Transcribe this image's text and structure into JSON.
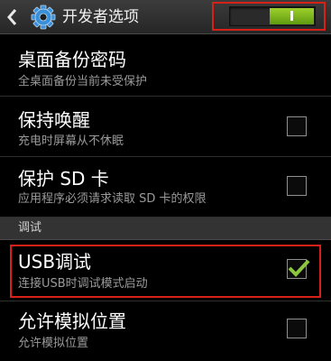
{
  "action_bar": {
    "title": "开发者选项",
    "toggle_state": "I"
  },
  "items": [
    {
      "title": "桌面备份密码",
      "summary": "全桌面备份当前未受保护"
    },
    {
      "title": "保持唤醒",
      "summary": "充电时屏幕从不休眠",
      "checked": false
    },
    {
      "title": "保护 SD 卡",
      "summary": "应用程序必须请求读取 SD 卡的权限",
      "checked": false
    }
  ],
  "section": {
    "label": "调试"
  },
  "debug_items": [
    {
      "title": "USB调试",
      "summary": "连接USB时调试模式启动",
      "checked": true
    },
    {
      "title": "允许模拟位置",
      "summary": "允许模拟位置",
      "checked": false
    }
  ],
  "colors": {
    "highlight": "#d8201a",
    "toggle_on": "#8cc63f",
    "check": "#8cc63f"
  },
  "icons": [
    "back-icon",
    "gear-icon",
    "check-icon"
  ]
}
